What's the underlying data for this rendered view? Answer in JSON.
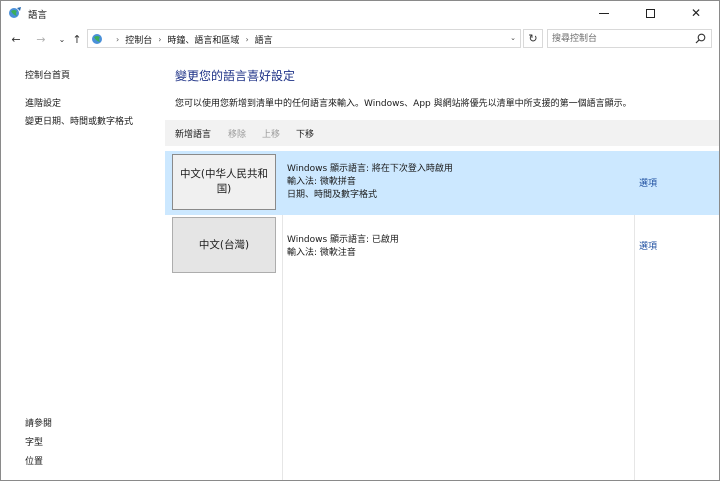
{
  "window": {
    "title": "語言",
    "minimize_label": "minimize",
    "maximize_label": "maximize",
    "close_label": "✕"
  },
  "address": {
    "breadcrumbs": [
      "控制台",
      "時鐘、語言和區域",
      "語言"
    ],
    "search_placeholder": "搜尋控制台"
  },
  "sidebar": {
    "top_links": [
      "控制台首頁",
      "進階設定",
      "變更日期、時間或數字格式"
    ],
    "see_also_title": "請參閱",
    "see_also_links": [
      "字型",
      "位置"
    ]
  },
  "main": {
    "title": "變更您的語言喜好設定",
    "description": "您可以使用您新增到清單中的任何語言來輸入。Windows、App 與網站將優先以清單中所支援的第一個語言顯示。",
    "toolbar": {
      "add": "新增語言",
      "remove": "移除",
      "move_up": "上移",
      "move_down": "下移"
    },
    "languages": [
      {
        "name": "中文(中华人民共和国)",
        "details": [
          "Windows 顯示語言: 將在下次登入時啟用",
          "輸入法: 微軟拼音",
          "日期、時間及數字格式"
        ],
        "options": "選項",
        "selected": true
      },
      {
        "name": "中文(台灣)",
        "details": [
          "Windows 顯示語言: 已啟用",
          "輸入法: 微軟注音"
        ],
        "options": "選項",
        "selected": false
      }
    ]
  },
  "colors": {
    "accent_title": "#1e3287",
    "link": "#1e4fa0",
    "selection": "#cce8ff",
    "toolbar_bg": "#f2f2f2"
  }
}
